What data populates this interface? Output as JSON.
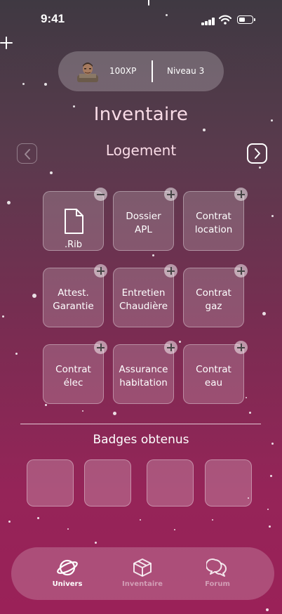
{
  "status_bar": {
    "time": "9:41"
  },
  "profile": {
    "xp": "100XP",
    "level": "Niveau 3"
  },
  "header": {
    "title": "Inventaire",
    "section": "Logement"
  },
  "inventory": {
    "items": [
      {
        "label": ".Rib",
        "action": "remove",
        "icon": "file-icon"
      },
      {
        "label": "Dossier\nAPL",
        "action": "add"
      },
      {
        "label": "Contrat\nlocation",
        "action": "add"
      },
      {
        "label": "Attest.\nGarantie",
        "action": "add"
      },
      {
        "label": "Entretien\nChaudière",
        "action": "add"
      },
      {
        "label": "Contrat\ngaz",
        "action": "add"
      },
      {
        "label": "Contrat\nélec",
        "action": "add"
      },
      {
        "label": "Assurance\nhabitation",
        "action": "add"
      },
      {
        "label": "Contrat\neau",
        "action": "add"
      }
    ]
  },
  "badges": {
    "title": "Badges obtenus"
  },
  "tabbar": {
    "tabs": [
      {
        "label": "Univers",
        "icon": "planet-icon",
        "active": true
      },
      {
        "label": "Inventaire",
        "icon": "box-icon",
        "active": false
      },
      {
        "label": "Forum",
        "icon": "chat-bubbles-icon",
        "active": false
      }
    ]
  },
  "colors": {
    "background_top": "#3f3942",
    "background_bottom": "#9a2158",
    "title": "#f9dbe6"
  }
}
